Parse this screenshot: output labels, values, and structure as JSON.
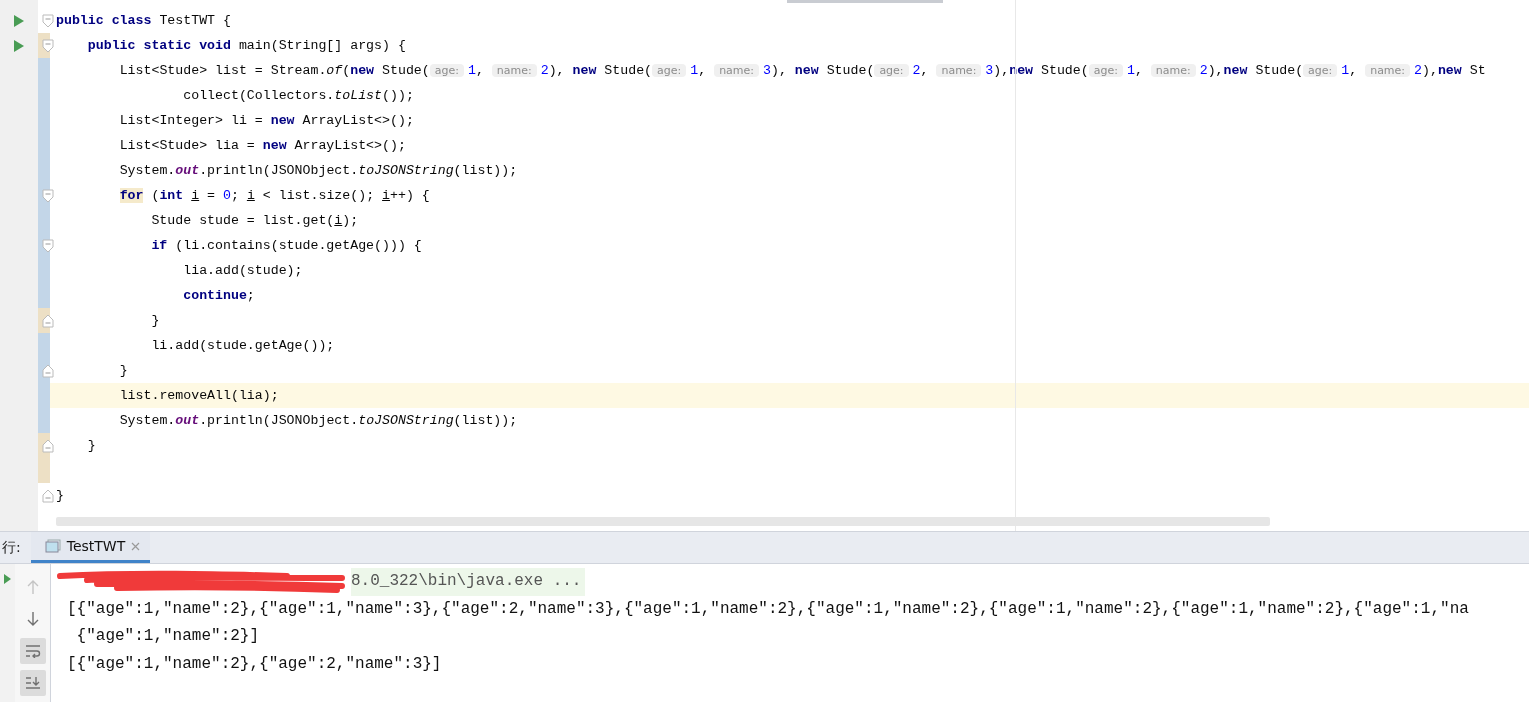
{
  "editor": {
    "code_lines": [
      {
        "run": true,
        "fold_open": true,
        "fold_close": false,
        "modified": false,
        "added": false,
        "current": false,
        "segments": [
          {
            "kind": "kw",
            "text": "public class"
          },
          {
            "kind": "plain",
            "text": " TestTWT {"
          }
        ]
      },
      {
        "run": true,
        "fold_open": true,
        "fold_close": false,
        "modified": false,
        "added": true,
        "current": false,
        "segments": [
          {
            "kind": "kw",
            "text": "    public static void"
          },
          {
            "kind": "plain",
            "text": " main(String[] args) {"
          }
        ]
      },
      {
        "run": false,
        "fold_open": false,
        "fold_close": false,
        "modified": true,
        "added": false,
        "current": false,
        "segments": [
          {
            "kind": "plain",
            "text": "        List<Stude> list = Stream."
          },
          {
            "kind": "static",
            "text": "of"
          },
          {
            "kind": "plain",
            "text": "("
          },
          {
            "kind": "kw",
            "text": "new"
          },
          {
            "kind": "plain",
            "text": " Stude("
          },
          {
            "kind": "hint",
            "text": "age:"
          },
          {
            "kind": "num",
            "text": "1"
          },
          {
            "kind": "plain",
            "text": ", "
          },
          {
            "kind": "hint",
            "text": "name:"
          },
          {
            "kind": "num",
            "text": "2"
          },
          {
            "kind": "plain",
            "text": "), "
          },
          {
            "kind": "kw",
            "text": "new"
          },
          {
            "kind": "plain",
            "text": " Stude("
          },
          {
            "kind": "hint",
            "text": "age:"
          },
          {
            "kind": "num",
            "text": "1"
          },
          {
            "kind": "plain",
            "text": ", "
          },
          {
            "kind": "hint",
            "text": "name:"
          },
          {
            "kind": "num",
            "text": "3"
          },
          {
            "kind": "plain",
            "text": "), "
          },
          {
            "kind": "kw",
            "text": "new"
          },
          {
            "kind": "plain",
            "text": " Stude("
          },
          {
            "kind": "hint",
            "text": "age:"
          },
          {
            "kind": "num",
            "text": "2"
          },
          {
            "kind": "plain",
            "text": ", "
          },
          {
            "kind": "hint",
            "text": "name:"
          },
          {
            "kind": "num",
            "text": "3"
          },
          {
            "kind": "plain",
            "text": "),"
          },
          {
            "kind": "kw",
            "text": "new"
          },
          {
            "kind": "plain",
            "text": " Stude("
          },
          {
            "kind": "hint",
            "text": "age:"
          },
          {
            "kind": "num",
            "text": "1"
          },
          {
            "kind": "plain",
            "text": ", "
          },
          {
            "kind": "hint",
            "text": "name:"
          },
          {
            "kind": "num",
            "text": "2"
          },
          {
            "kind": "plain",
            "text": "),"
          },
          {
            "kind": "kw",
            "text": "new"
          },
          {
            "kind": "plain",
            "text": " Stude("
          },
          {
            "kind": "hint",
            "text": "age:"
          },
          {
            "kind": "num",
            "text": "1"
          },
          {
            "kind": "plain",
            "text": ", "
          },
          {
            "kind": "hint",
            "text": "name:"
          },
          {
            "kind": "num",
            "text": "2"
          },
          {
            "kind": "plain",
            "text": "),"
          },
          {
            "kind": "kw",
            "text": "new"
          },
          {
            "kind": "plain",
            "text": " St"
          }
        ]
      },
      {
        "run": false,
        "fold_open": false,
        "fold_close": false,
        "modified": true,
        "added": false,
        "current": false,
        "segments": [
          {
            "kind": "plain",
            "text": "                collect(Collectors."
          },
          {
            "kind": "static",
            "text": "toList"
          },
          {
            "kind": "plain",
            "text": "());"
          }
        ]
      },
      {
        "run": false,
        "fold_open": false,
        "fold_close": false,
        "modified": true,
        "added": false,
        "current": false,
        "segments": [
          {
            "kind": "plain",
            "text": "        List<Integer> li = "
          },
          {
            "kind": "kw",
            "text": "new"
          },
          {
            "kind": "plain",
            "text": " ArrayList<>();"
          }
        ]
      },
      {
        "run": false,
        "fold_open": false,
        "fold_close": false,
        "modified": true,
        "added": false,
        "current": false,
        "segments": [
          {
            "kind": "plain",
            "text": "        List<Stude> lia = "
          },
          {
            "kind": "kw",
            "text": "new"
          },
          {
            "kind": "plain",
            "text": " ArrayList<>();"
          }
        ]
      },
      {
        "run": false,
        "fold_open": false,
        "fold_close": false,
        "modified": true,
        "added": false,
        "current": false,
        "segments": [
          {
            "kind": "plain",
            "text": "        System."
          },
          {
            "kind": "field",
            "text": "out"
          },
          {
            "kind": "plain",
            "text": ".println(JSONObject."
          },
          {
            "kind": "static",
            "text": "toJSONString"
          },
          {
            "kind": "plain",
            "text": "(list));"
          }
        ]
      },
      {
        "run": false,
        "fold_open": true,
        "fold_close": false,
        "modified": true,
        "added": false,
        "current": false,
        "segments": [
          {
            "kind": "kw_match",
            "text": "        for"
          },
          {
            "kind": "plain",
            "text": " ("
          },
          {
            "kind": "kw",
            "text": "int "
          },
          {
            "kind": "var",
            "text": "i"
          },
          {
            "kind": "plain",
            "text": " = "
          },
          {
            "kind": "num",
            "text": "0"
          },
          {
            "kind": "plain",
            "text": "; "
          },
          {
            "kind": "var",
            "text": "i"
          },
          {
            "kind": "plain",
            "text": " < list.size(); "
          },
          {
            "kind": "var",
            "text": "i"
          },
          {
            "kind": "plain",
            "text": "++) {"
          }
        ]
      },
      {
        "run": false,
        "fold_open": false,
        "fold_close": false,
        "modified": true,
        "added": false,
        "current": false,
        "segments": [
          {
            "kind": "plain",
            "text": "            Stude stude = list.get("
          },
          {
            "kind": "var",
            "text": "i"
          },
          {
            "kind": "plain",
            "text": ");"
          }
        ]
      },
      {
        "run": false,
        "fold_open": true,
        "fold_close": false,
        "modified": true,
        "added": false,
        "current": false,
        "segments": [
          {
            "kind": "kw",
            "text": "            if"
          },
          {
            "kind": "plain",
            "text": " (li.contains(stude.getAge())) {"
          }
        ]
      },
      {
        "run": false,
        "fold_open": false,
        "fold_close": false,
        "modified": true,
        "added": false,
        "current": false,
        "segments": [
          {
            "kind": "plain",
            "text": "                lia.add(stude);"
          }
        ]
      },
      {
        "run": false,
        "fold_open": false,
        "fold_close": false,
        "modified": true,
        "added": false,
        "current": false,
        "segments": [
          {
            "kind": "kw",
            "text": "                continue"
          },
          {
            "kind": "plain",
            "text": ";"
          }
        ]
      },
      {
        "run": false,
        "fold_open": false,
        "fold_close": true,
        "modified": false,
        "added": true,
        "current": false,
        "segments": [
          {
            "kind": "plain",
            "text": "            }"
          }
        ]
      },
      {
        "run": false,
        "fold_open": false,
        "fold_close": false,
        "modified": true,
        "added": false,
        "current": false,
        "segments": [
          {
            "kind": "plain",
            "text": "            li.add(stude.getAge());"
          }
        ]
      },
      {
        "run": false,
        "fold_open": false,
        "fold_close": true,
        "modified": true,
        "added": false,
        "current": false,
        "segments": [
          {
            "kind": "plain",
            "text": "        }"
          }
        ]
      },
      {
        "run": false,
        "fold_open": false,
        "fold_close": false,
        "modified": true,
        "added": false,
        "current": true,
        "segments": [
          {
            "kind": "plain",
            "text": "        list.removeAll(lia);"
          }
        ]
      },
      {
        "run": false,
        "fold_open": false,
        "fold_close": false,
        "modified": true,
        "added": false,
        "current": false,
        "segments": [
          {
            "kind": "plain",
            "text": "        System."
          },
          {
            "kind": "field",
            "text": "out"
          },
          {
            "kind": "plain",
            "text": ".println(JSONObject."
          },
          {
            "kind": "static",
            "text": "toJSONString"
          },
          {
            "kind": "plain",
            "text": "(list));"
          }
        ]
      },
      {
        "run": false,
        "fold_open": false,
        "fold_close": true,
        "modified": false,
        "added": true,
        "current": false,
        "segments": [
          {
            "kind": "plain",
            "text": "    }"
          }
        ]
      },
      {
        "run": false,
        "fold_open": false,
        "fold_close": false,
        "modified": false,
        "added": true,
        "current": false
      },
      {
        "run": false,
        "fold_open": false,
        "fold_close": true,
        "modified": false,
        "added": false,
        "current": false,
        "segments": [
          {
            "kind": "plain",
            "text": "}"
          }
        ]
      }
    ]
  },
  "run_panel": {
    "label": "行:",
    "tabs": [
      {
        "label": "TestTWT",
        "selected": true,
        "closable": true
      }
    ],
    "tools": [
      {
        "kind": "up",
        "disabled": true,
        "toggled": false
      },
      {
        "kind": "down",
        "disabled": false,
        "toggled": false
      },
      {
        "kind": "wrap",
        "disabled": false,
        "toggled": true
      },
      {
        "kind": "scroll_end",
        "disabled": false,
        "toggled": true
      }
    ],
    "console_lines": [
      {
        "kind": "command",
        "redacted": true,
        "text": "8.0_322\\bin\\java.exe ..."
      },
      {
        "kind": "output",
        "redacted": false,
        "text": "[{\"age\":1,\"name\":2},{\"age\":1,\"name\":3},{\"age\":2,\"name\":3},{\"age\":1,\"name\":2},{\"age\":1,\"name\":2},{\"age\":1,\"name\":2},{\"age\":1,\"name\":2},{\"age\":1,\"na"
      },
      {
        "kind": "output",
        "redacted": false,
        "text": " {\"age\":1,\"name\":2}]"
      },
      {
        "kind": "output",
        "redacted": false,
        "text": "[{\"age\":1,\"name\":2},{\"age\":2,\"name\":3}]"
      }
    ]
  }
}
